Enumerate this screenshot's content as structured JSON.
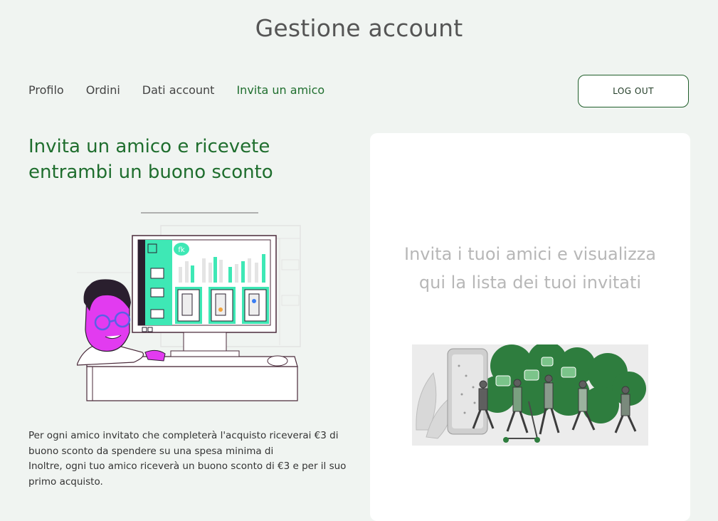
{
  "page": {
    "title": "Gestione account"
  },
  "tabs": [
    {
      "label": "Profilo",
      "active": false
    },
    {
      "label": "Ordini",
      "active": false
    },
    {
      "label": "Dati account",
      "active": false
    },
    {
      "label": "Invita un amico",
      "active": true
    }
  ],
  "logout": {
    "label": "LOG OUT"
  },
  "invite": {
    "headline_line1": "Invita un amico e ricevete",
    "headline_line2": "entrambi un buono sconto",
    "desc_line1": "Per ogni amico invitato che completerà l'acquisto riceverai €3 di",
    "desc_line2": "buono sconto da spendere su una spesa minima di",
    "desc_line3": "Inoltre, ogni tuo amico riceverà un buono sconto di €3 e per il suo",
    "desc_line4": "primo acquisto.",
    "screen_badge": "fk"
  },
  "panel": {
    "empty_line1": "Invita i tuoi amici e visualizza",
    "empty_line2": "qui la lista dei tuoi invitati"
  },
  "colors": {
    "brand_green": "#1f6e2e",
    "accent_teal": "#3ee8b5",
    "accent_magenta": "#e23bf0",
    "background": "#f0f4f1"
  },
  "icons": {
    "left_illustration": "person-at-computer-illustration",
    "right_illustration": "friends-running-illustration"
  }
}
